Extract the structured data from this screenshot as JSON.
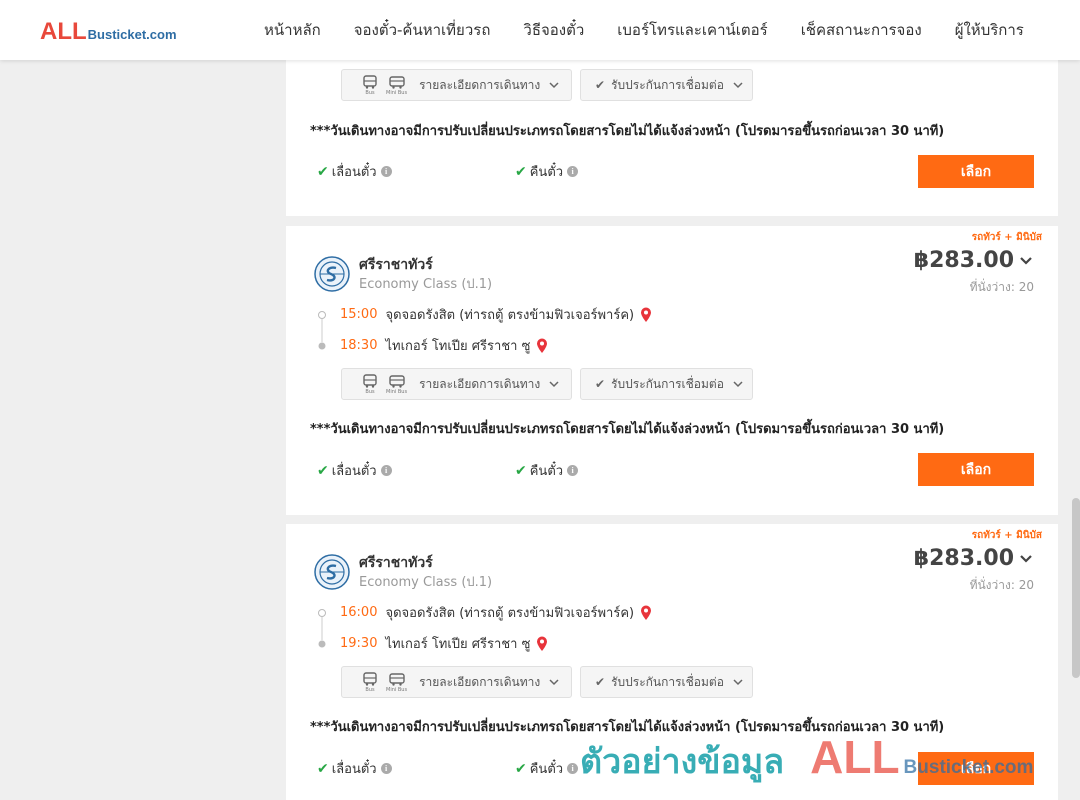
{
  "header": {
    "logo_all": "ALL",
    "logo_busticket": "Busticket.com",
    "nav": [
      "หน้าหลัก",
      "จองตั๋ว-ค้นหาเที่ยวรถ",
      "วิธีจองตั๋ว",
      "เบอร์โทรและเคาน์เตอร์",
      "เช็คสถานะการจอง",
      "ผู้ให้บริการ"
    ]
  },
  "common": {
    "bus_label": "Bus",
    "minibus_label": "Mini Bus",
    "detail_label": "รายละเอียดการเดินทาง",
    "guarantee_label": "รับประกันการเชื่อมต่อ",
    "notice": "***วันเดินทางอาจมีการปรับเปลี่ยนประเภทรถโดยสารโดยไม่ได้แจ้งล่วงหน้า (โปรดมารอขึ้นรถก่อนเวลา 30 นาที)",
    "change_label": "เลื่อนตั๋ว",
    "refund_label": "คืนตั๋ว",
    "select_label": "เลือก",
    "accent": "#ff6a13"
  },
  "trips": [
    {
      "tag": "รถทัวร์ + มินิบัส",
      "operator": "ศรีราชาทัวร์",
      "class": "Economy Class (ป.1)",
      "price": "฿283.00",
      "seats": "ที่นั่งว่าง: 20",
      "depart_time": "15:00",
      "depart_place": "จุดจอดรังสิต (ท่ารถตู้ ตรงข้ามฟิวเจอร์พาร์ค)",
      "arrive_time": "18:30",
      "arrive_place": "ไทเกอร์ โทเปีย ศรีราชา ซู"
    },
    {
      "tag": "รถทัวร์ + มินิบัส",
      "operator": "ศรีราชาทัวร์",
      "class": "Economy Class (ป.1)",
      "price": "฿283.00",
      "seats": "ที่นั่งว่าง: 20",
      "depart_time": "16:00",
      "depart_place": "จุดจอดรังสิต (ท่ารถตู้ ตรงข้ามฟิวเจอร์พาร์ค)",
      "arrive_time": "19:30",
      "arrive_place": "ไทเกอร์ โทเปีย ศรีราชา ซู"
    }
  ],
  "watermark": {
    "text": "ตัวอย่างข้อมูล",
    "all": "ALL",
    "busticket": "Busticket.com"
  }
}
